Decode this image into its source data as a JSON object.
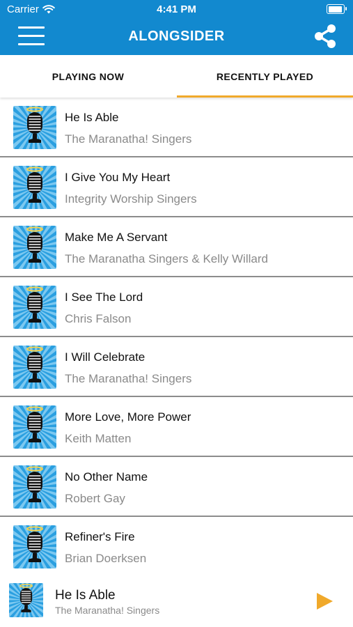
{
  "status_bar": {
    "carrier": "Carrier",
    "time": "4:41 PM"
  },
  "header": {
    "title": "ALONGSIDER",
    "menu_icon": "hamburger-menu-icon",
    "share_icon": "share-icon"
  },
  "tabs": [
    {
      "label": "PLAYING NOW",
      "active": false
    },
    {
      "label": "RECENTLY PLAYED",
      "active": true
    }
  ],
  "tracks": [
    {
      "title": "He Is Able",
      "artist": "The Maranatha! Singers"
    },
    {
      "title": "I Give You My Heart",
      "artist": "Integrity Worship Singers"
    },
    {
      "title": "Make Me A Servant",
      "artist": "The Maranatha Singers & Kelly Willard"
    },
    {
      "title": "I See The Lord",
      "artist": "Chris Falson"
    },
    {
      "title": "I Will Celebrate",
      "artist": "The Maranatha! Singers"
    },
    {
      "title": "More Love, More Power",
      "artist": "Keith Matten"
    },
    {
      "title": "No Other Name",
      "artist": "Robert Gay"
    },
    {
      "title": "Refiner's Fire",
      "artist": "Brian Doerksen"
    }
  ],
  "now_playing": {
    "title": "He Is Able",
    "artist": "The Maranatha! Singers",
    "play_icon": "play-icon"
  },
  "colors": {
    "header_blue": "#1289cf",
    "accent_orange": "#f0a92b",
    "art_blue": "#2a9fe0"
  }
}
